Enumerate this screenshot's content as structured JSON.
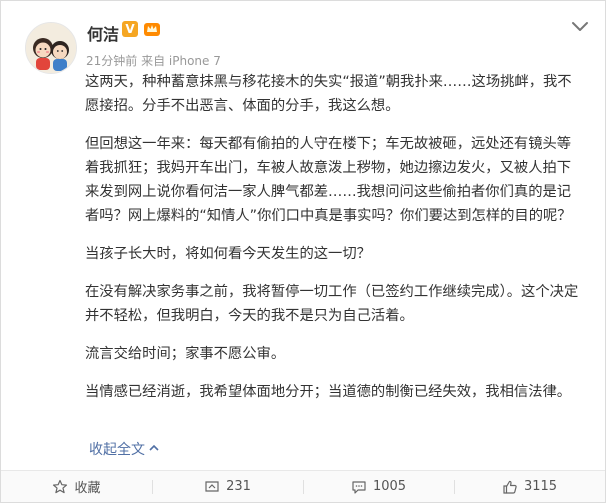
{
  "post": {
    "author": "何洁",
    "verified_badge": "V",
    "meta": "21分钟前 来自 iPhone 7",
    "paragraphs": [
      "这两天，种种蓄意抹黑与移花接木的失实“报道”朝我扑来……这场挑衅，我不愿接招。分手不出恶言、体面的分手，我这么想。",
      "但回想这一年来：每天都有偷拍的人守在楼下；车无故被砸，远处还有镜头等着我抓狂；我妈开车出门，车被人故意泼上秽物，她边擦边发火，又被人拍下来发到网上说你看何洁一家人脾气都差……我想问问这些偷拍者你们真的是记者吗？网上爆料的“知情人”你们口中真是事实吗？你们要达到怎样的目的呢？",
      "当孩子长大时，将如何看今天发生的这一切？",
      "在没有解决家务事之前，我将暂停一切工作（已签约工作继续完成）。这个决定并不轻松，但我明白，今天的我不是只为自己活着。",
      "流言交给时间；家事不愿公审。",
      "当情感已经消逝，我希望体面地分开；当道德的制衡已经失效，我相信法律。"
    ],
    "collapse_label": "收起全文"
  },
  "actions": {
    "favorite_label": "收藏",
    "repost_count": "231",
    "comment_count": "1005",
    "like_count": "3115"
  },
  "icons": {
    "avatar": "cartoon-avatar",
    "member": "member-crown-icon",
    "menu": "chevron-down-icon",
    "favorite": "star-icon",
    "repost": "repost-icon",
    "comment": "comment-icon",
    "like": "thumbs-up-icon"
  },
  "colors": {
    "link": "#5170a5",
    "badge": "#f5a623"
  }
}
